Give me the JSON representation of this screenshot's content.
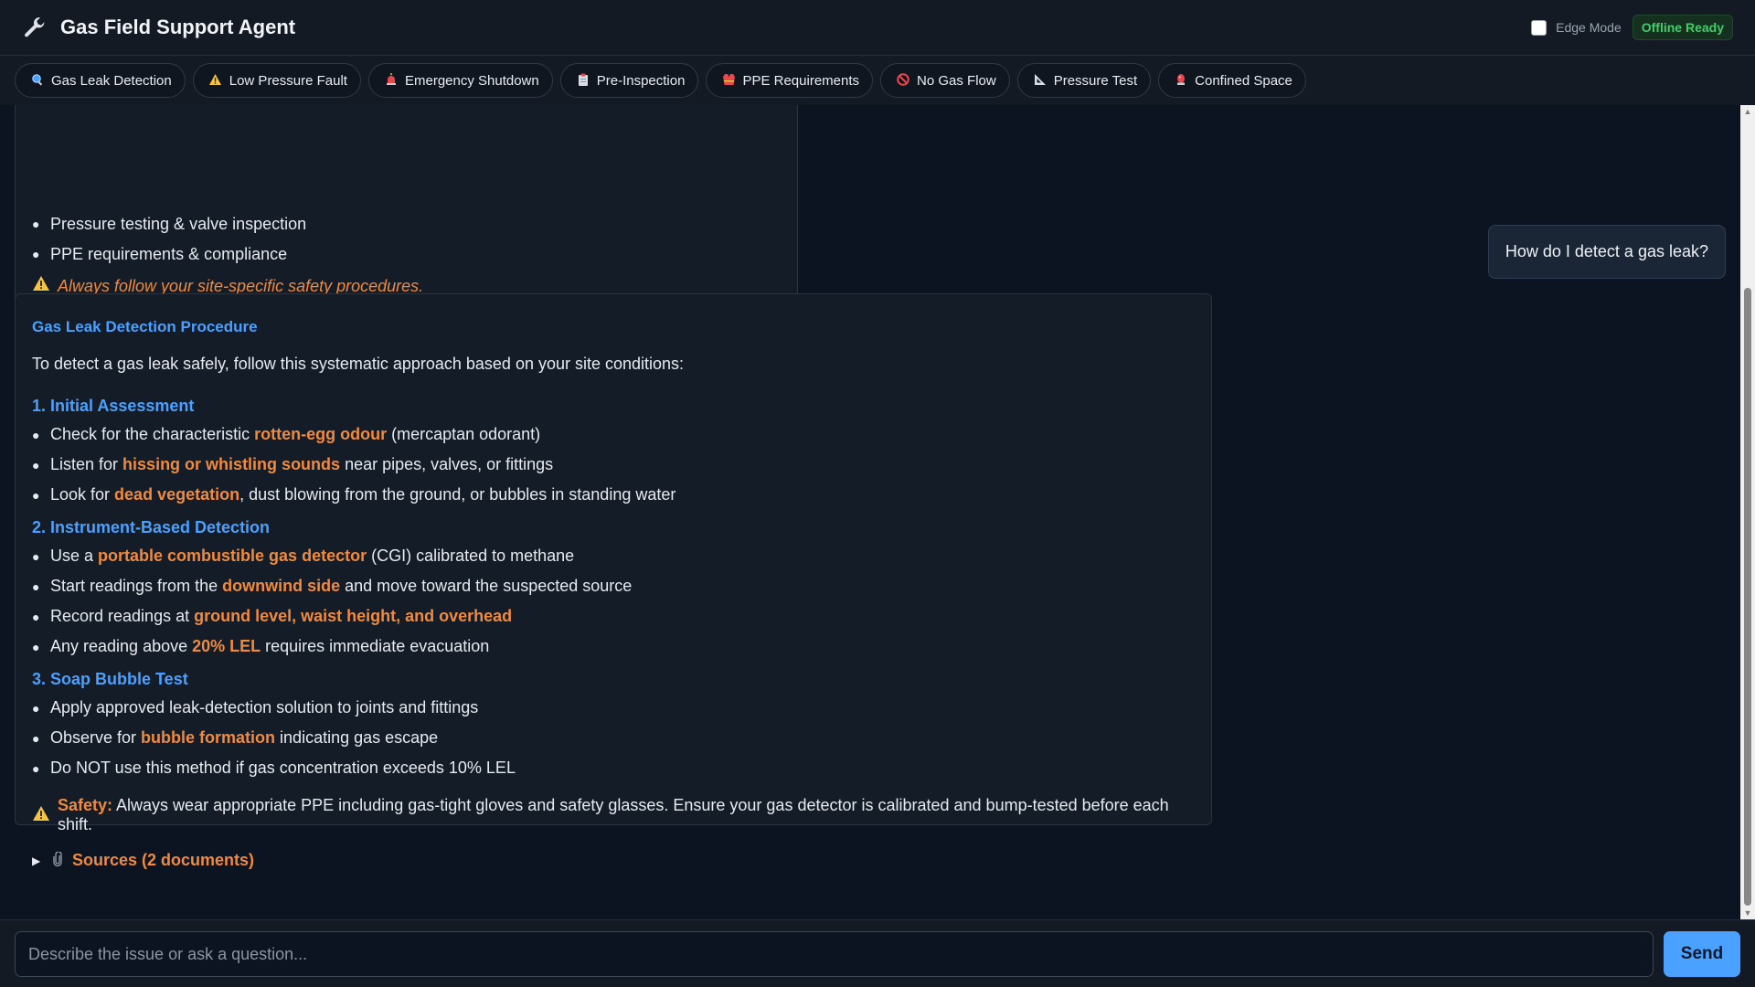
{
  "header": {
    "title": "Gas Field Support Agent",
    "edge_mode_label": "Edge Mode",
    "status_badge": "Offline Ready",
    "edge_mode_checked": false
  },
  "quick_actions": [
    {
      "icon": "magnifier-icon",
      "label": "Gas Leak Detection"
    },
    {
      "icon": "warning-icon",
      "label": "Low Pressure Fault"
    },
    {
      "icon": "siren-icon",
      "label": "Emergency Shutdown"
    },
    {
      "icon": "clipboard-icon",
      "label": "Pre-Inspection"
    },
    {
      "icon": "vest-icon",
      "label": "PPE Requirements"
    },
    {
      "icon": "no-entry-icon",
      "label": "No Gas Flow"
    },
    {
      "icon": "ruler-icon",
      "label": "Pressure Test"
    },
    {
      "icon": "alarm-light-icon",
      "label": "Confined Space"
    }
  ],
  "previous_message": {
    "bullets": [
      "Pressure testing & valve inspection",
      "PPE requirements & compliance"
    ],
    "warning": "Always follow your site-specific safety procedures."
  },
  "user_message": "How do I detect a gas leak?",
  "answer": {
    "title": "Gas Leak Detection Procedure",
    "intro": "To detect a gas leak safely, follow this systematic approach based on your site conditions:",
    "sections": [
      {
        "heading": "1. Initial Assessment",
        "items": [
          {
            "pre": "Check for the characteristic ",
            "hl": "rotten-egg odour",
            "post": " (mercaptan odorant)"
          },
          {
            "pre": "Listen for ",
            "hl": "hissing or whistling sounds",
            "post": " near pipes, valves, or fittings"
          },
          {
            "pre": "Look for ",
            "hl": "dead vegetation",
            "post": ", dust blowing from the ground, or bubbles in standing water"
          }
        ]
      },
      {
        "heading": "2. Instrument-Based Detection",
        "items": [
          {
            "pre": "Use a ",
            "hl": "portable combustible gas detector",
            "post": " (CGI) calibrated to methane"
          },
          {
            "pre": "Start readings from the ",
            "hl": "downwind side",
            "post": " and move toward the suspected source"
          },
          {
            "pre": "Record readings at ",
            "hl": "ground level, waist height, and overhead",
            "post": ""
          },
          {
            "pre": "Any reading above ",
            "hl": "20% LEL",
            "post": " requires immediate evacuation"
          }
        ]
      },
      {
        "heading": "3. Soap Bubble Test",
        "items": [
          {
            "pre": "Apply approved leak-detection solution to joints and fittings",
            "hl": "",
            "post": ""
          },
          {
            "pre": "Observe for ",
            "hl": "bubble formation",
            "post": " indicating gas escape"
          },
          {
            "pre": "Do NOT use this method if gas concentration exceeds 10% LEL",
            "hl": "",
            "post": ""
          }
        ]
      }
    ],
    "safety_label": "Safety:",
    "safety_text": " Always wear appropriate PPE including gas-tight gloves and safety glasses. Ensure your gas detector is calibrated and bump-tested before each shift.",
    "sources_label": "Sources (2 documents)"
  },
  "composer": {
    "placeholder": "Describe the issue or ask a question...",
    "send_label": "Send"
  },
  "colors": {
    "accent_blue": "#4aa1ff",
    "highlight_orange": "#f08a3c",
    "status_green": "#3fce6b",
    "background": "#0d1421"
  }
}
